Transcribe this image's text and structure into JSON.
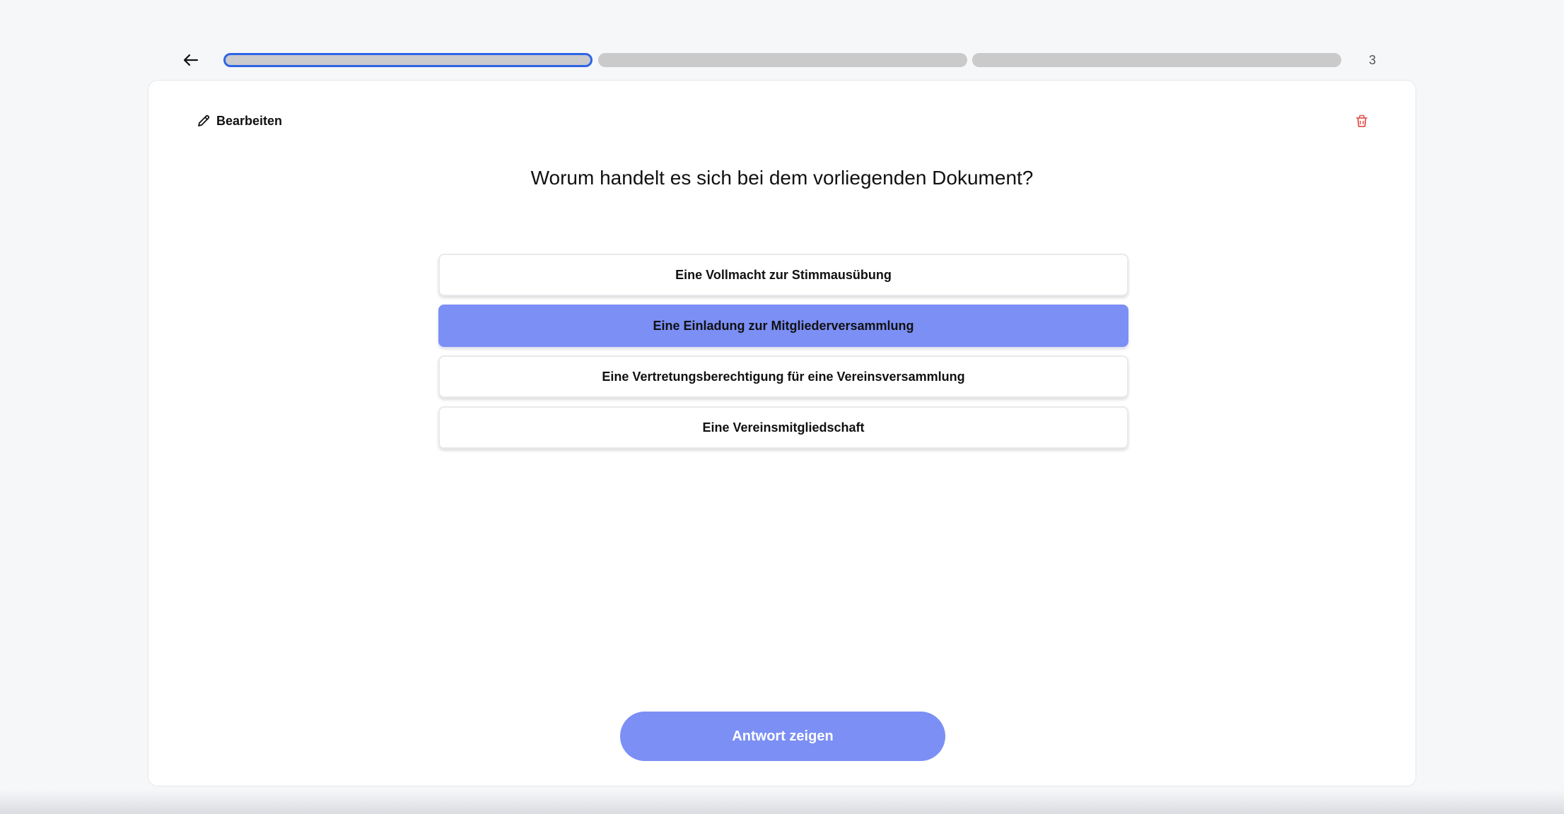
{
  "topbar": {
    "step_count": "3"
  },
  "progress": {
    "segments": [
      {
        "state": "active"
      },
      {
        "state": "inactive"
      },
      {
        "state": "inactive"
      }
    ]
  },
  "card": {
    "edit_label": "Bearbeiten",
    "question": "Worum handelt es sich bei dem vorliegenden Dokument?",
    "options": [
      {
        "label": "Eine Vollmacht zur Stimmausübung",
        "selected": false
      },
      {
        "label": "Eine Einladung zur Mitgliederversammlung",
        "selected": true
      },
      {
        "label": "Eine Vertretungsberechtigung für eine Vereinsversammlung",
        "selected": false
      },
      {
        "label": "Eine Vereinsmitgliedschaft",
        "selected": false
      }
    ],
    "show_answer_label": "Antwort zeigen"
  },
  "icons": {
    "back": "arrow-left-icon",
    "edit": "pencil-icon",
    "delete": "trash-icon"
  },
  "colors": {
    "accent": "#7b8ff5",
    "progress_active_border": "#2f64e6",
    "progress_inactive": "#cacaca",
    "delete_icon": "#e5534b"
  }
}
